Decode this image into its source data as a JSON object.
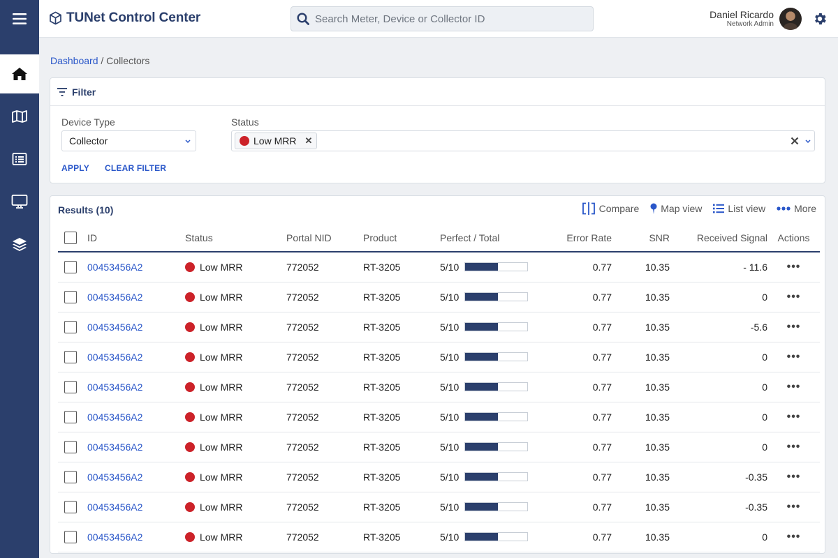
{
  "app": {
    "title": "TUNet Control Center",
    "search_placeholder": "Search Meter, Device or Collector ID"
  },
  "user": {
    "name": "Daniel Ricardo",
    "role": "Network Admin"
  },
  "sidebar": {
    "items": [
      {
        "icon": "home-icon",
        "active": true
      },
      {
        "icon": "map-icon",
        "active": false
      },
      {
        "icon": "list-icon",
        "active": false
      },
      {
        "icon": "monitor-icon",
        "active": false
      },
      {
        "icon": "layers-icon",
        "active": false
      }
    ]
  },
  "breadcrumb": {
    "root": "Dashboard",
    "separator": "/",
    "current": "Collectors"
  },
  "filter": {
    "title": "Filter",
    "device_type_label": "Device Type",
    "device_type_value": "Collector",
    "status_label": "Status",
    "status_chip": "Low MRR",
    "apply_label": "APPLY",
    "clear_label": "CLEAR FILTER"
  },
  "results": {
    "title": "Results (10)",
    "toolbar": {
      "compare": "Compare",
      "map_view": "Map view",
      "list_view": "List view",
      "more": "More"
    },
    "columns": [
      "ID",
      "Status",
      "Portal NID",
      "Product",
      "Perfect / Total",
      "Error Rate",
      "SNR",
      "Received Signal",
      "Actions"
    ],
    "rows": [
      {
        "id": "00453456A2",
        "status": "Low MRR",
        "portal_nid": "772052",
        "product": "RT-3205",
        "ratio": "5/10",
        "fill": 0.53,
        "error_rate": "0.77",
        "snr": "10.35",
        "received_signal": "- 11.6"
      },
      {
        "id": "00453456A2",
        "status": "Low MRR",
        "portal_nid": "772052",
        "product": "RT-3205",
        "ratio": "5/10",
        "fill": 0.53,
        "error_rate": "0.77",
        "snr": "10.35",
        "received_signal": "0"
      },
      {
        "id": "00453456A2",
        "status": "Low MRR",
        "portal_nid": "772052",
        "product": "RT-3205",
        "ratio": "5/10",
        "fill": 0.53,
        "error_rate": "0.77",
        "snr": "10.35",
        "received_signal": "-5.6"
      },
      {
        "id": "00453456A2",
        "status": "Low MRR",
        "portal_nid": "772052",
        "product": "RT-3205",
        "ratio": "5/10",
        "fill": 0.53,
        "error_rate": "0.77",
        "snr": "10.35",
        "received_signal": "0"
      },
      {
        "id": "00453456A2",
        "status": "Low MRR",
        "portal_nid": "772052",
        "product": "RT-3205",
        "ratio": "5/10",
        "fill": 0.53,
        "error_rate": "0.77",
        "snr": "10.35",
        "received_signal": "0"
      },
      {
        "id": "00453456A2",
        "status": "Low MRR",
        "portal_nid": "772052",
        "product": "RT-3205",
        "ratio": "5/10",
        "fill": 0.53,
        "error_rate": "0.77",
        "snr": "10.35",
        "received_signal": "0"
      },
      {
        "id": "00453456A2",
        "status": "Low MRR",
        "portal_nid": "772052",
        "product": "RT-3205",
        "ratio": "5/10",
        "fill": 0.53,
        "error_rate": "0.77",
        "snr": "10.35",
        "received_signal": "0"
      },
      {
        "id": "00453456A2",
        "status": "Low MRR",
        "portal_nid": "772052",
        "product": "RT-3205",
        "ratio": "5/10",
        "fill": 0.53,
        "error_rate": "0.77",
        "snr": "10.35",
        "received_signal": "-0.35"
      },
      {
        "id": "00453456A2",
        "status": "Low MRR",
        "portal_nid": "772052",
        "product": "RT-3205",
        "ratio": "5/10",
        "fill": 0.53,
        "error_rate": "0.77",
        "snr": "10.35",
        "received_signal": "-0.35"
      },
      {
        "id": "00453456A2",
        "status": "Low MRR",
        "portal_nid": "772052",
        "product": "RT-3205",
        "ratio": "5/10",
        "fill": 0.53,
        "error_rate": "0.77",
        "snr": "10.35",
        "received_signal": "0"
      }
    ]
  },
  "colors": {
    "navy": "#2b3f6c",
    "link": "#2a57c9",
    "status_red": "#cc2229"
  }
}
